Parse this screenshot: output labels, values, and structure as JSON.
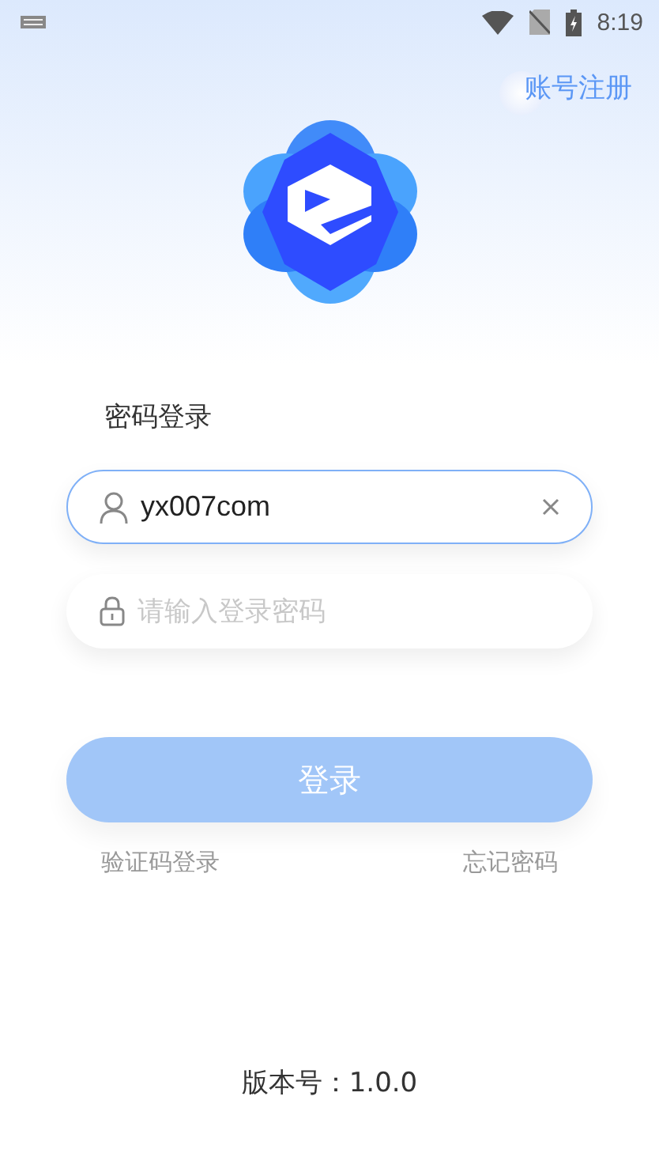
{
  "status_bar": {
    "time": "8:19"
  },
  "register_link": "账号注册",
  "title": "密码登录",
  "username": {
    "value": "yx007com",
    "focused": true
  },
  "password": {
    "placeholder": "请输入登录密码",
    "focused": false
  },
  "login_button": {
    "label": "登录",
    "disabled": true
  },
  "links": [
    "验证码登录",
    "忘记密码"
  ],
  "version": "版本号：1.0.0"
}
